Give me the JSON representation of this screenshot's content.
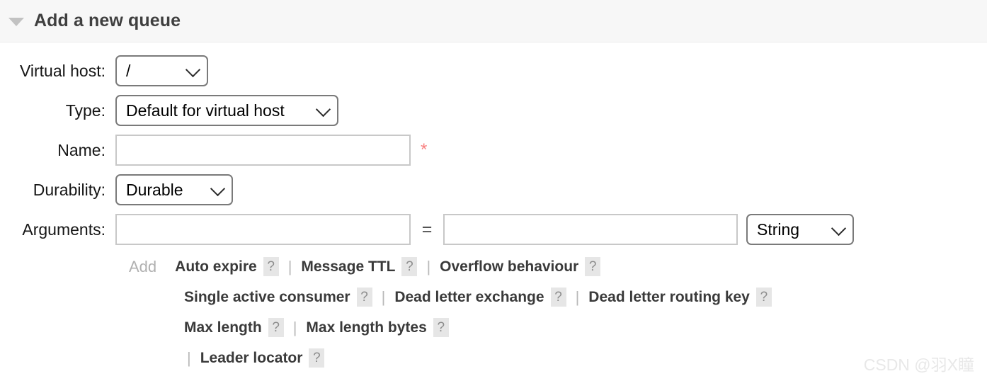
{
  "section": {
    "title": "Add a new queue",
    "collapse_icon": "triangle-down-icon"
  },
  "form": {
    "virtual_host": {
      "label": "Virtual host:",
      "value": "/"
    },
    "type": {
      "label": "Type:",
      "value": "Default for virtual host"
    },
    "name": {
      "label": "Name:",
      "value": "",
      "placeholder": "",
      "required_marker": "*"
    },
    "durability": {
      "label": "Durability:",
      "value": "Durable"
    },
    "arguments": {
      "label": "Arguments:",
      "key_value": "",
      "key_placeholder": "",
      "equals": "=",
      "value_value": "",
      "value_placeholder": "",
      "type_value": "String",
      "add_label": "Add"
    }
  },
  "presets": {
    "help_glyph": "?",
    "separator": "|",
    "rows": [
      [
        {
          "label": "Auto expire",
          "help": "?"
        },
        {
          "label": "Message TTL",
          "help": "?"
        },
        {
          "label": "Overflow behaviour",
          "help": "?"
        }
      ],
      [
        {
          "label": "Single active consumer",
          "help": "?"
        },
        {
          "label": "Dead letter exchange",
          "help": "?"
        },
        {
          "label": "Dead letter routing key",
          "help": "?"
        }
      ],
      [
        {
          "label": "Max length",
          "help": "?"
        },
        {
          "label": "Max length bytes",
          "help": "?"
        }
      ],
      [
        {
          "label": "Leader locator",
          "help": "?"
        }
      ]
    ]
  },
  "watermark": {
    "text": "CSDN @羽X瞳"
  },
  "colors": {
    "header_bg": "#f7f7f7",
    "required_star": "#f98080",
    "link_text": "#3a3a3a",
    "muted": "#b0b0b0"
  }
}
